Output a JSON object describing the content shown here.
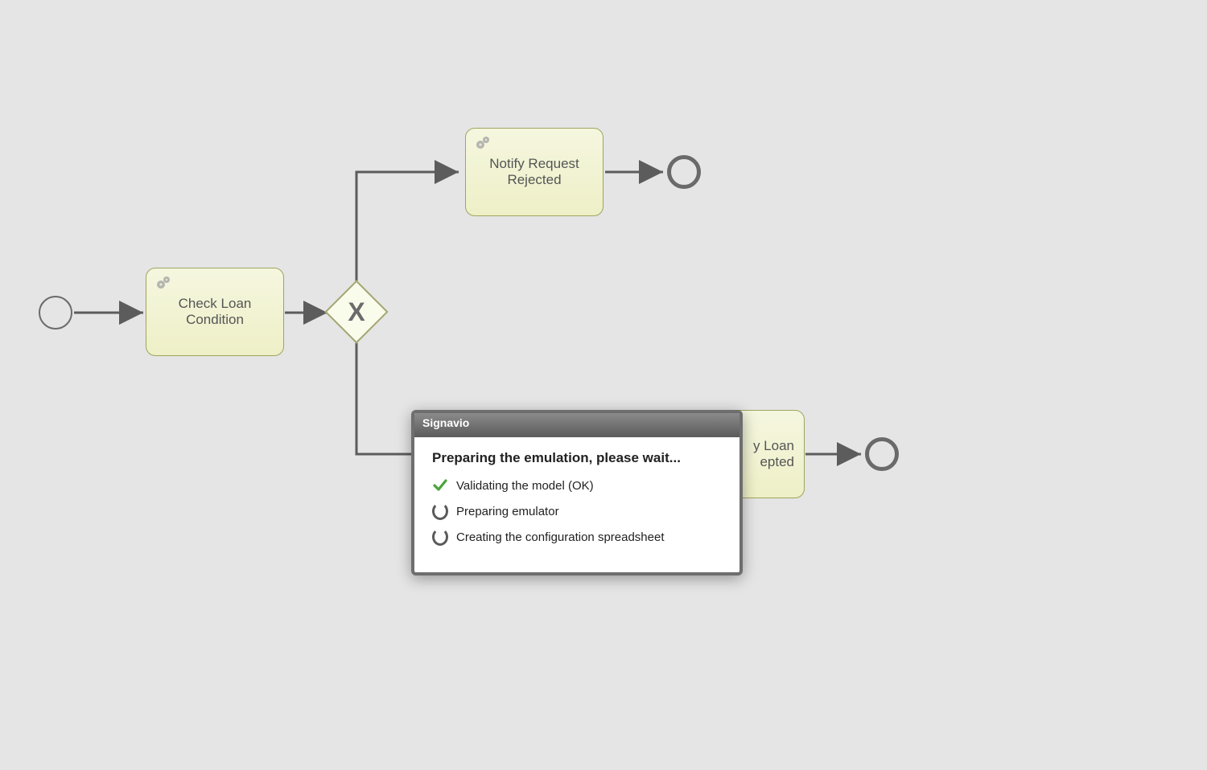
{
  "tasks": {
    "check_loan": "Check Loan\nCondition",
    "notify_rejected": "Notify Request\nRejected",
    "notify_accepted_partial_right": "y Loan\nepted"
  },
  "dialog": {
    "title": "Signavio",
    "heading": "Preparing the emulation, please wait...",
    "step1": "Validating the model (OK)",
    "step2": "Preparing emulator",
    "step3": "Creating the configuration spreadsheet"
  }
}
